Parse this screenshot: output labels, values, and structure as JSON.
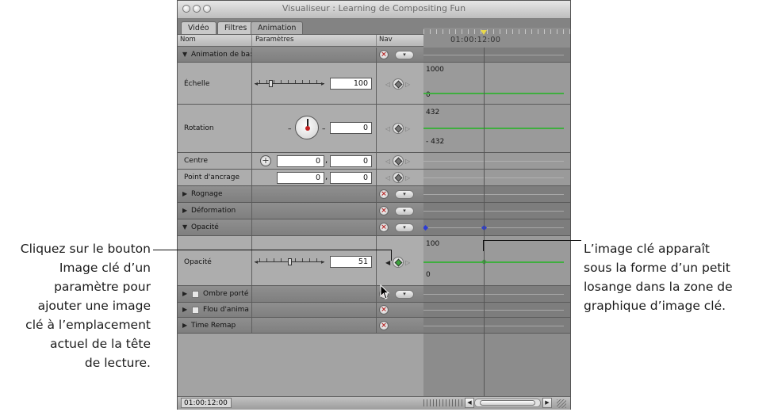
{
  "window": {
    "title": "Visualiseur : Learning de Compositing Fun",
    "tabs": [
      {
        "label": "Vidéo"
      },
      {
        "label": "Filtres"
      },
      {
        "label": "Animation"
      }
    ],
    "columns": {
      "name": "Nom",
      "params": "Paramètres",
      "nav": "Nav"
    },
    "ruler_time": "01:00:12:00"
  },
  "rows": {
    "anim_base": {
      "label": "Animation de ba:"
    },
    "scale": {
      "label": "Échelle",
      "value": "100"
    },
    "rotation": {
      "label": "Rotation",
      "value": "0"
    },
    "center": {
      "label": "Centre",
      "x": "0",
      "sep": ",",
      "y": "0"
    },
    "anchor": {
      "label": "Point d'ancrage",
      "x": "0",
      "sep": ",",
      "y": "0"
    },
    "crop": {
      "label": "Rognage"
    },
    "distort": {
      "label": "Déformation"
    },
    "opacity_section": {
      "label": "Opacité"
    },
    "opacity": {
      "label": "Opacité",
      "value": "51"
    },
    "drop_shadow": {
      "label": "Ombre porté"
    },
    "motion_blur": {
      "label": "Flou d'anima"
    },
    "time_remap": {
      "label": "Time Remap"
    }
  },
  "graph": {
    "scale_max": "1000",
    "scale_min": "0",
    "rot_max": "432",
    "rot_min": "- 432",
    "opac_max": "100",
    "opac_min": "0"
  },
  "bottom": {
    "timecode": "01:00:12:00"
  },
  "callouts": {
    "left": [
      "Cliquez sur le bouton",
      "Image clé d’un",
      "paramètre pour",
      "ajouter une image",
      "clé à l’emplacement",
      "actuel de la tête",
      "de lecture."
    ],
    "right": [
      "L’image clé apparaît",
      "sous la forme d’un petit",
      "losange dans la zone de",
      "graphique d’image clé."
    ]
  },
  "icons": {
    "keyframe_button": "diamond-icon",
    "reset": "x-circle-icon",
    "menu": "popup-menu-icon",
    "disclosure": "triangle-icon"
  },
  "accent_colors": {
    "curve": "#3fae3f",
    "keyframe": "#3da33d",
    "reset": "#b32222",
    "playhead_marker": "#e8d84a"
  }
}
